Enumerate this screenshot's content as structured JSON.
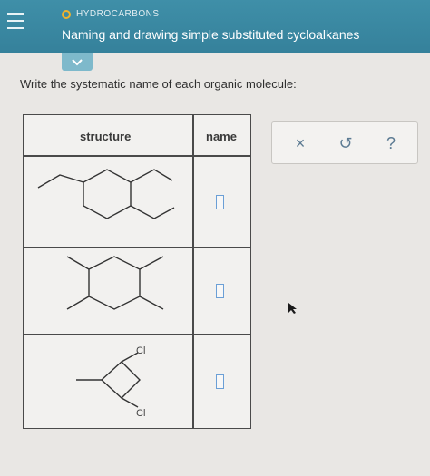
{
  "header": {
    "topic": "HYDROCARBONS",
    "title": "Naming and drawing simple substituted cycloalkanes"
  },
  "instruction": "Write the systematic name of each organic molecule:",
  "table": {
    "headers": {
      "structure": "structure",
      "name": "name"
    },
    "rows": [
      {
        "labels": []
      },
      {
        "labels": []
      },
      {
        "labels": [
          "Cl",
          "Cl"
        ]
      }
    ]
  },
  "toolbar": {
    "clear": "×",
    "undo": "↺",
    "help": "?"
  },
  "colors": {
    "header": "#3a8aa3",
    "accent_dot": "#f2b32a",
    "answer_box": "#6b9fd6",
    "background": "#e9e7e4"
  },
  "icons": [
    "menu-icon",
    "chevron-down-icon",
    "close-icon",
    "undo-icon",
    "help-icon",
    "mouse-cursor-icon"
  ]
}
